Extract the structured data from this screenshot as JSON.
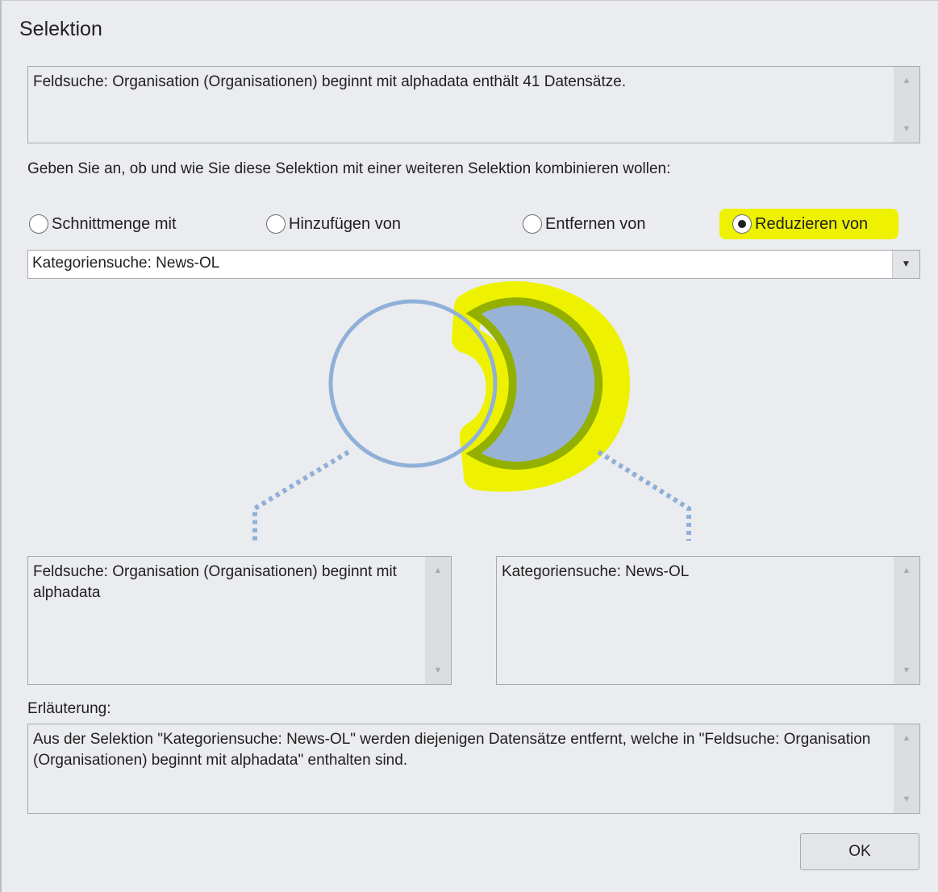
{
  "window": {
    "title": "Selektion"
  },
  "summary": {
    "text": "Feldsuche: Organisation (Organisationen) beginnt mit alphadata enthält 41 Datensätze."
  },
  "prompt": {
    "text": "Geben Sie an, ob und wie Sie diese Selektion mit einer weiteren Selektion kombinieren wollen:"
  },
  "options": [
    {
      "label": "Schnittmenge mit",
      "checked": false
    },
    {
      "label": "Hinzufügen von",
      "checked": false
    },
    {
      "label": "Entfernen von",
      "checked": false
    },
    {
      "label": "Reduzieren von",
      "checked": true
    }
  ],
  "combo": {
    "value": "Kategoriensuche: News-OL"
  },
  "left_box": {
    "text": "Feldsuche: Organisation (Organisationen) beginnt mit alphadata"
  },
  "right_box": {
    "text": "Kategoriensuche: News-OL"
  },
  "explanation": {
    "label": "Erläuterung:",
    "text": "Aus der Selektion \"Kategoriensuche: News-OL\" werden diejenigen Datensätze entfernt, welche in \"Feldsuche: Organisation (Organisationen) beginnt mit alphadata\" enthalten sind."
  },
  "buttons": {
    "ok": "OK"
  },
  "colors": {
    "highlight": "#eef200",
    "venn_outline": "#8fb0d8",
    "venn_fill": "#98b3d6",
    "venn_ring": "#93b000"
  },
  "icons": {
    "scroll_up": "chevron-up-icon",
    "scroll_down": "chevron-down-icon",
    "combo_arrow": "chevron-down-icon"
  }
}
